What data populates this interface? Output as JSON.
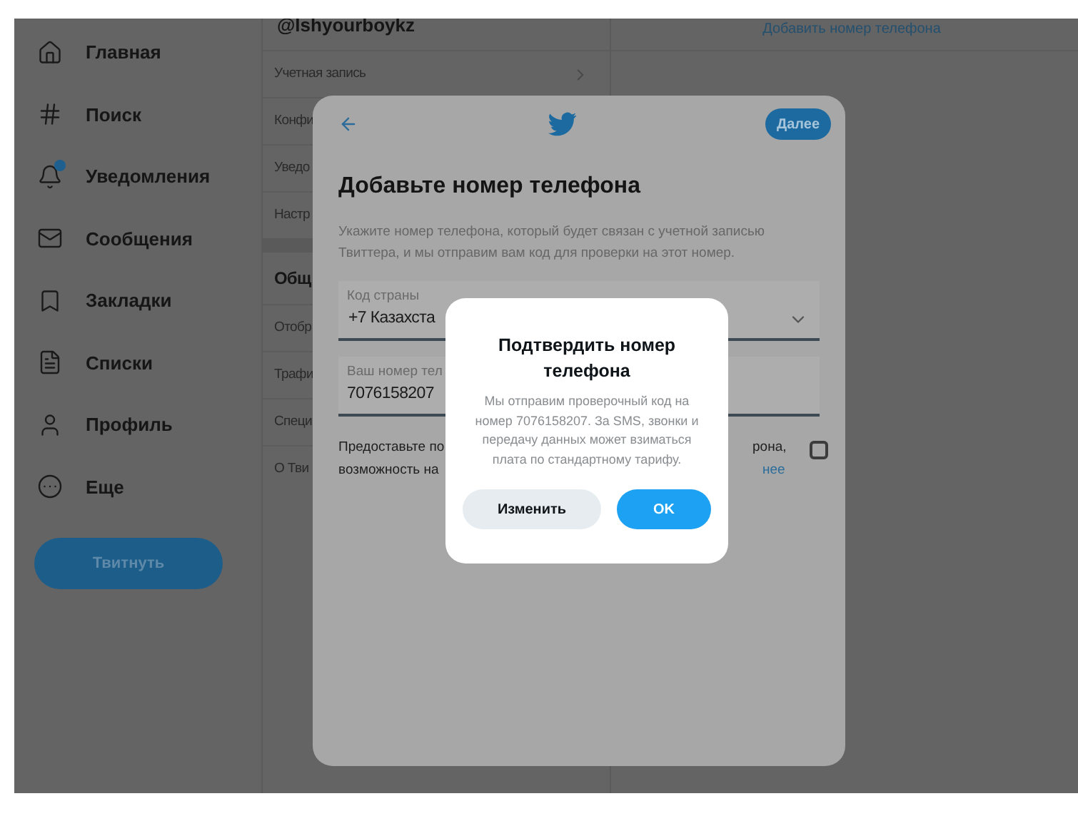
{
  "sidebar": {
    "items": [
      {
        "label": "Главная",
        "kind": "home"
      },
      {
        "label": "Поиск",
        "kind": "hash"
      },
      {
        "label": "Уведомления",
        "kind": "bell"
      },
      {
        "label": "Сообщения",
        "kind": "mail"
      },
      {
        "label": "Закладки",
        "kind": "bookmark"
      },
      {
        "label": "Списки",
        "kind": "list"
      },
      {
        "label": "Профиль",
        "kind": "user"
      },
      {
        "label": "Еще",
        "kind": "more"
      }
    ],
    "tweet_button": "Твитнуть"
  },
  "settings": {
    "title": "@lshyourboykz",
    "items": [
      {
        "label": "Учетная запись",
        "chevron": true
      },
      {
        "label": "Конфи",
        "chevron": false
      },
      {
        "label": "Уведо",
        "chevron": false
      },
      {
        "label": "Настр",
        "chevron": false
      }
    ],
    "section": {
      "title": "Общ",
      "items": [
        {
          "label": "Отобр"
        },
        {
          "label": "Трафи"
        },
        {
          "label": "Специ"
        },
        {
          "label": "О Тви"
        }
      ]
    }
  },
  "right_panel": {
    "link": "Добавить номер телефона"
  },
  "modal": {
    "next_button": "Далее",
    "title": "Добавьте номер телефона",
    "description": "Укажите номер телефона, который будет связан с учетной записью Твиттера, и мы отправим вам код для проверки на этот номер.",
    "fields": [
      {
        "kind": "select",
        "label": "Код страны",
        "value": "+7 Казахста"
      },
      {
        "kind": "text",
        "label": "Ваш номер тел",
        "value": "7076158207"
      }
    ],
    "consent": {
      "left_lines": [
        "Предоставьте по",
        "возможность на"
      ],
      "right_text": "рона,",
      "link": "нее",
      "checked": false
    }
  },
  "dialog": {
    "title": "Подтвердить номер телефона",
    "text": "Мы отправим проверочный код на номер 7076158207. За SMS, звонки и передачу данных может взиматься плата по стандартному тарифу.",
    "buttons": [
      {
        "kind": "secondary",
        "label": "Изменить"
      },
      {
        "kind": "primary",
        "label": "OK"
      }
    ]
  }
}
